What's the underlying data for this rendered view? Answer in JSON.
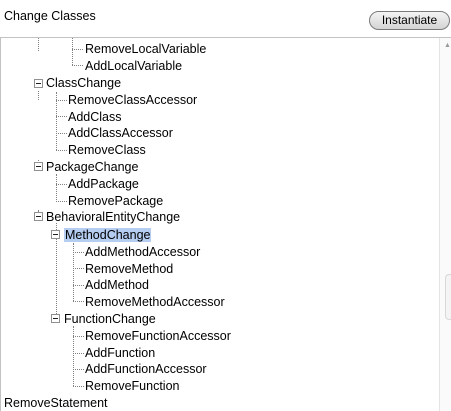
{
  "header": {
    "title": "Change Classes",
    "instantiate_label": "Instantiate"
  },
  "tree": {
    "selected": "MethodChange",
    "items": [
      {
        "label": "RemoveLocalVariable"
      },
      {
        "label": "AddLocalVariable"
      },
      {
        "label": "ClassChange"
      },
      {
        "label": "RemoveClassAccessor"
      },
      {
        "label": "AddClass"
      },
      {
        "label": "AddClassAccessor"
      },
      {
        "label": "RemoveClass"
      },
      {
        "label": "PackageChange"
      },
      {
        "label": "AddPackage"
      },
      {
        "label": "RemovePackage"
      },
      {
        "label": "BehavioralEntityChange"
      },
      {
        "label": "MethodChange"
      },
      {
        "label": "AddMethodAccessor"
      },
      {
        "label": "RemoveMethod"
      },
      {
        "label": "AddMethod"
      },
      {
        "label": "RemoveMethodAccessor"
      },
      {
        "label": "FunctionChange"
      },
      {
        "label": "RemoveFunctionAccessor"
      },
      {
        "label": "AddFunction"
      },
      {
        "label": "AddFunctionAccessor"
      },
      {
        "label": "RemoveFunction"
      },
      {
        "label": "RemoveStatement"
      }
    ]
  },
  "icons": {
    "expander": "collapse-box-icon",
    "scroll_up": "scroll-up-arrow-icon"
  },
  "colors": {
    "selection": "#b6cdf2",
    "button_border": "#7a7a7a"
  }
}
